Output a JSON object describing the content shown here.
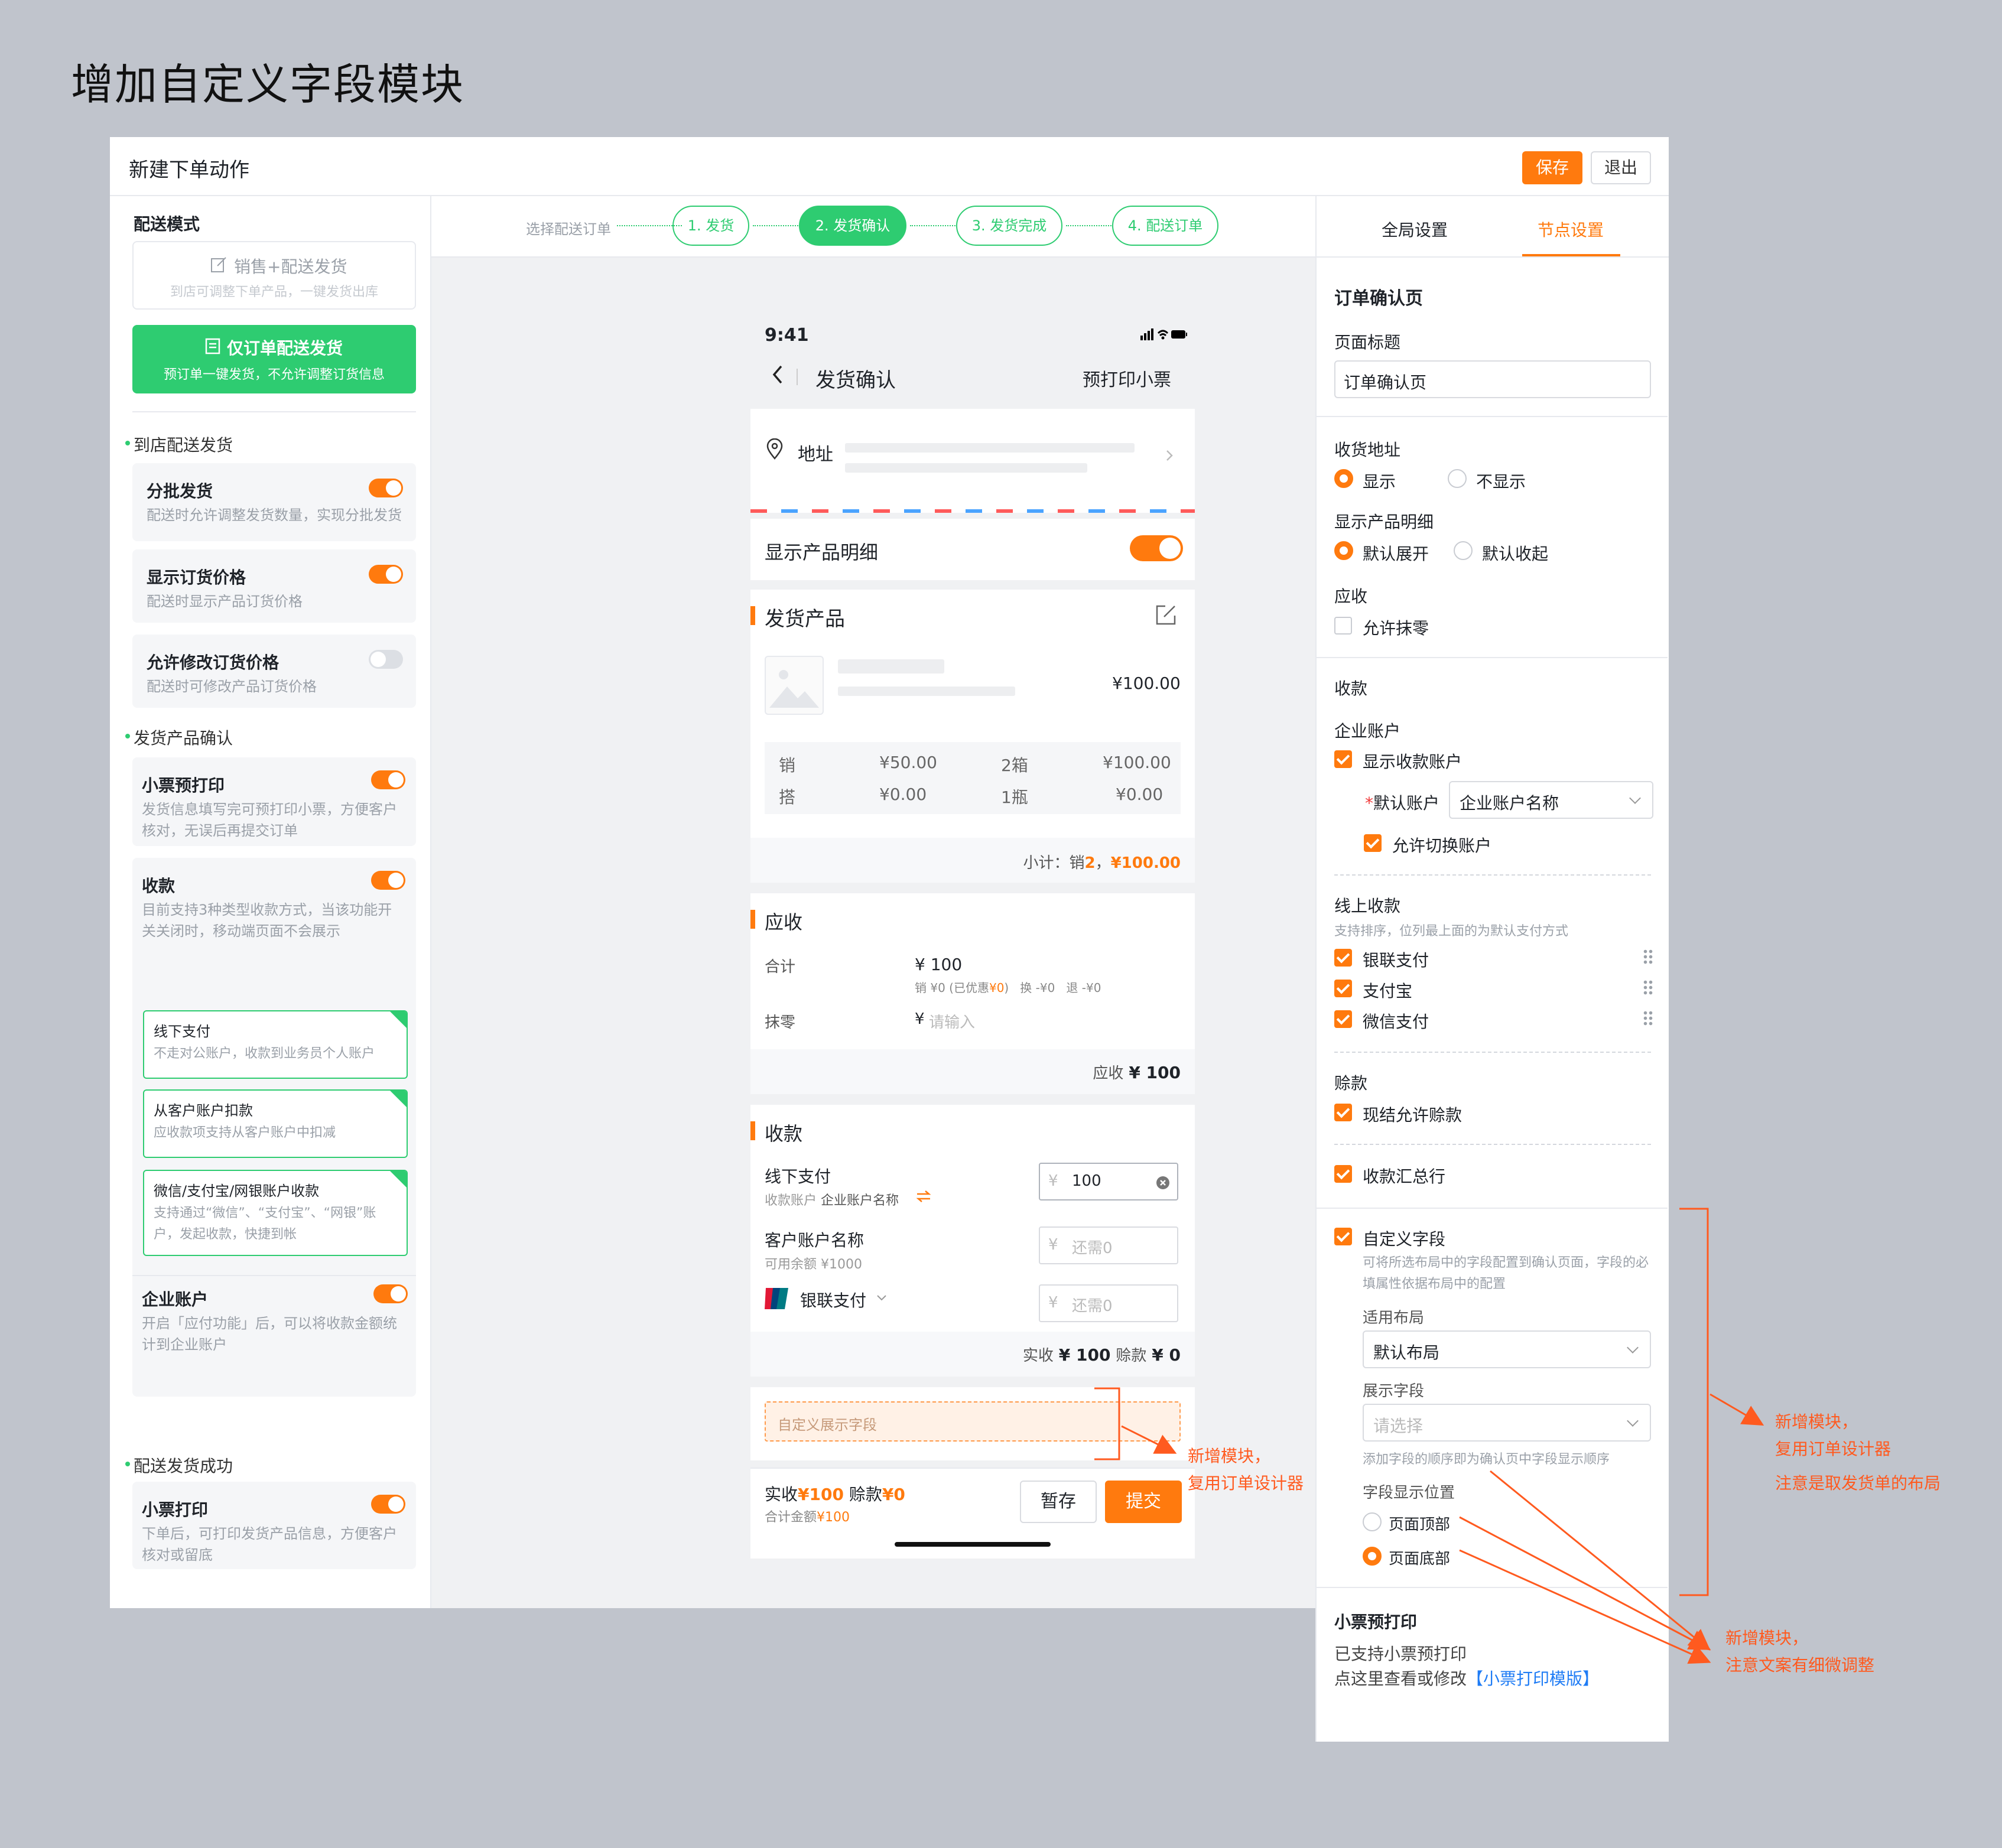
{
  "heading": "增加自定义字段模块",
  "window": {
    "title": "新建下单动作",
    "save": "保存",
    "exit": "退出"
  },
  "left": {
    "mode_title": "配送模式",
    "mode1": {
      "title": "销售+配送发货",
      "desc": "到店可调整下单产品，一键发货出库"
    },
    "mode2": {
      "title": "仅订单配送发货",
      "desc": "预订单一键发货，不允许调整订货信息"
    },
    "sec1": "到店配送发货",
    "batch": {
      "title": "分批发货",
      "desc": "配送时允许调整发货数量，实现分批发货",
      "on": true
    },
    "price": {
      "title": "显示订货价格",
      "desc": "配送时显示产品订货价格",
      "on": true
    },
    "modify": {
      "title": "允许修改订货价格",
      "desc": "配送时可修改产品订货价格",
      "on": false
    },
    "sec2": "发货产品确认",
    "ticket": {
      "title": "小票预打印",
      "desc": "发货信息填写完可预打印小票，方便客户核对，无误后再提交订单",
      "on": true
    },
    "collect": {
      "title": "收款",
      "desc": "目前支持3种类型收款方式，当该功能开关关闭时，移动端页面不会展示",
      "on": true
    },
    "pay1": {
      "title": "线下支付",
      "desc": "不走对公账户，收款到业务员个人账户"
    },
    "pay2": {
      "title": "从客户账户扣款",
      "desc": "应收款项支持从客户账户中扣减"
    },
    "pay3": {
      "title": "微信/支付宝/网银账户收款",
      "desc": "支持通过“微信”、“支付宝”、“网银”账户，发起收款，快捷到帐"
    },
    "corp": {
      "title": "企业账户",
      "desc": "开启「应付功能」后，可以将收款金额统计到企业账户",
      "on": true
    },
    "sec3": "配送发货成功",
    "print": {
      "title": "小票打印",
      "desc": "下单后，可打印发货产品信息，方便客户核对或留底",
      "on": true
    }
  },
  "steps": {
    "pre": "选择配送订单",
    "s1": "1. 发货",
    "s2": "2. 发货确认",
    "s3": "3. 发货完成",
    "s4": "4. 配送订单"
  },
  "phone": {
    "time": "9:41",
    "nav_title": "发货确认",
    "nav_right": "预打印小票",
    "address": "地址",
    "show_detail": "显示产品明细",
    "products_title": "发货产品",
    "product_price": "¥100.00",
    "rows": [
      {
        "tag": "销",
        "price": "¥50.00",
        "qty": "2箱",
        "amount": "¥100.00"
      },
      {
        "tag": "搭",
        "price": "¥0.00",
        "qty": "1瓶",
        "amount": "¥0.00"
      }
    ],
    "subtotal_label": "小计：销",
    "subtotal_count": "2",
    "subtotal_sep": "，",
    "subtotal_amount": "¥100.00",
    "recv_title": "应收",
    "total_label": "合计",
    "total_value": "¥ 100",
    "total_detail_a": "销 ¥0 (已优惠",
    "total_detail_b": "¥0",
    "total_detail_c": ")   换 -¥0   退 -¥0",
    "round_label": "抹零",
    "round_yen": "¥",
    "round_ph": "请输入",
    "recv_summary_label": "应收",
    "recv_summary_value": "¥ 100",
    "pay_title": "收款",
    "offline": {
      "title": "线下支付",
      "sub_label": "收款账户",
      "sub_value": "企业账户名称",
      "value": "100",
      "yen": "¥"
    },
    "customer": {
      "title": "客户账户名称",
      "sub": "可用余额  ¥1000",
      "ph": "还需0",
      "yen": "¥"
    },
    "unionpay": {
      "title": "银联支付",
      "ph": "还需0",
      "yen": "¥",
      "logo": "UnionPay 银联"
    },
    "pay_summary_a": "实收",
    "pay_summary_b": "¥ 100",
    "pay_summary_c": "赊款",
    "pay_summary_d": "¥ 0",
    "custom_ph": "自定义展示字段",
    "footer_a": "实收",
    "footer_b": "¥100",
    "footer_c": " 赊款",
    "footer_d": "¥0",
    "footer_sub_a": "合计金额",
    "footer_sub_b": "¥100",
    "save": "暂存",
    "submit": "提交"
  },
  "right": {
    "tab1": "全局设置",
    "tab2": "节点设置",
    "page_title": "订单确认页",
    "title_label": "页面标题",
    "title_value": "订单确认页",
    "addr_label": "收货地址",
    "show": "显示",
    "hide": "不显示",
    "detail_label": "显示产品明细",
    "expand": "默认展开",
    "collapse": "默认收起",
    "recv_label": "应收",
    "allow_round": "允许抹零",
    "collect_label": "收款",
    "corp_label": "企业账户",
    "show_account": "显示收款账户",
    "default_account": "默认账户",
    "required_mark": "*",
    "account_value": "企业账户名称",
    "switch_account": "允许切换账户",
    "online_label": "线上收款",
    "online_desc": "支持排序，位列最上面的为默认支付方式",
    "unionpay": "银联支付",
    "alipay": "支付宝",
    "wechat": "微信支付",
    "credit_label": "赊款",
    "credit_allow": "现结允许赊款",
    "summary_row": "收款汇总行",
    "custom_label": "自定义字段",
    "custom_desc": "可将所选布局中的字段配置到确认页面，字段的必填属性依据布局中的配置",
    "layout_label": "适用布局",
    "layout_value": "默认布局",
    "field_label": "展示字段",
    "field_ph": "请选择",
    "field_hint": "添加字段的顺序即为确认页中字段显示顺序",
    "pos_label": "字段显示位置",
    "pos_top": "页面顶部",
    "pos_bottom": "页面底部",
    "ticket_title": "小票预打印",
    "ticket_line1": "已支持小票预打印",
    "ticket_line2": "点这里查看或修改",
    "ticket_link": "【小票打印模版】"
  },
  "annotations": {
    "a1_1": "新增模块，",
    "a1_2": "复用订单设计器",
    "a2_1": "新增模块，",
    "a2_2": "复用订单设计器",
    "a2_3": "注意是取发货单的布局",
    "a3_1": "新增模块，",
    "a3_2": "注意文案有细微调整"
  },
  "colors": {
    "accent": "#ff7a0e",
    "green": "#2ecc71",
    "link": "#1f7cf5",
    "annotation": "#ff5a1f"
  }
}
